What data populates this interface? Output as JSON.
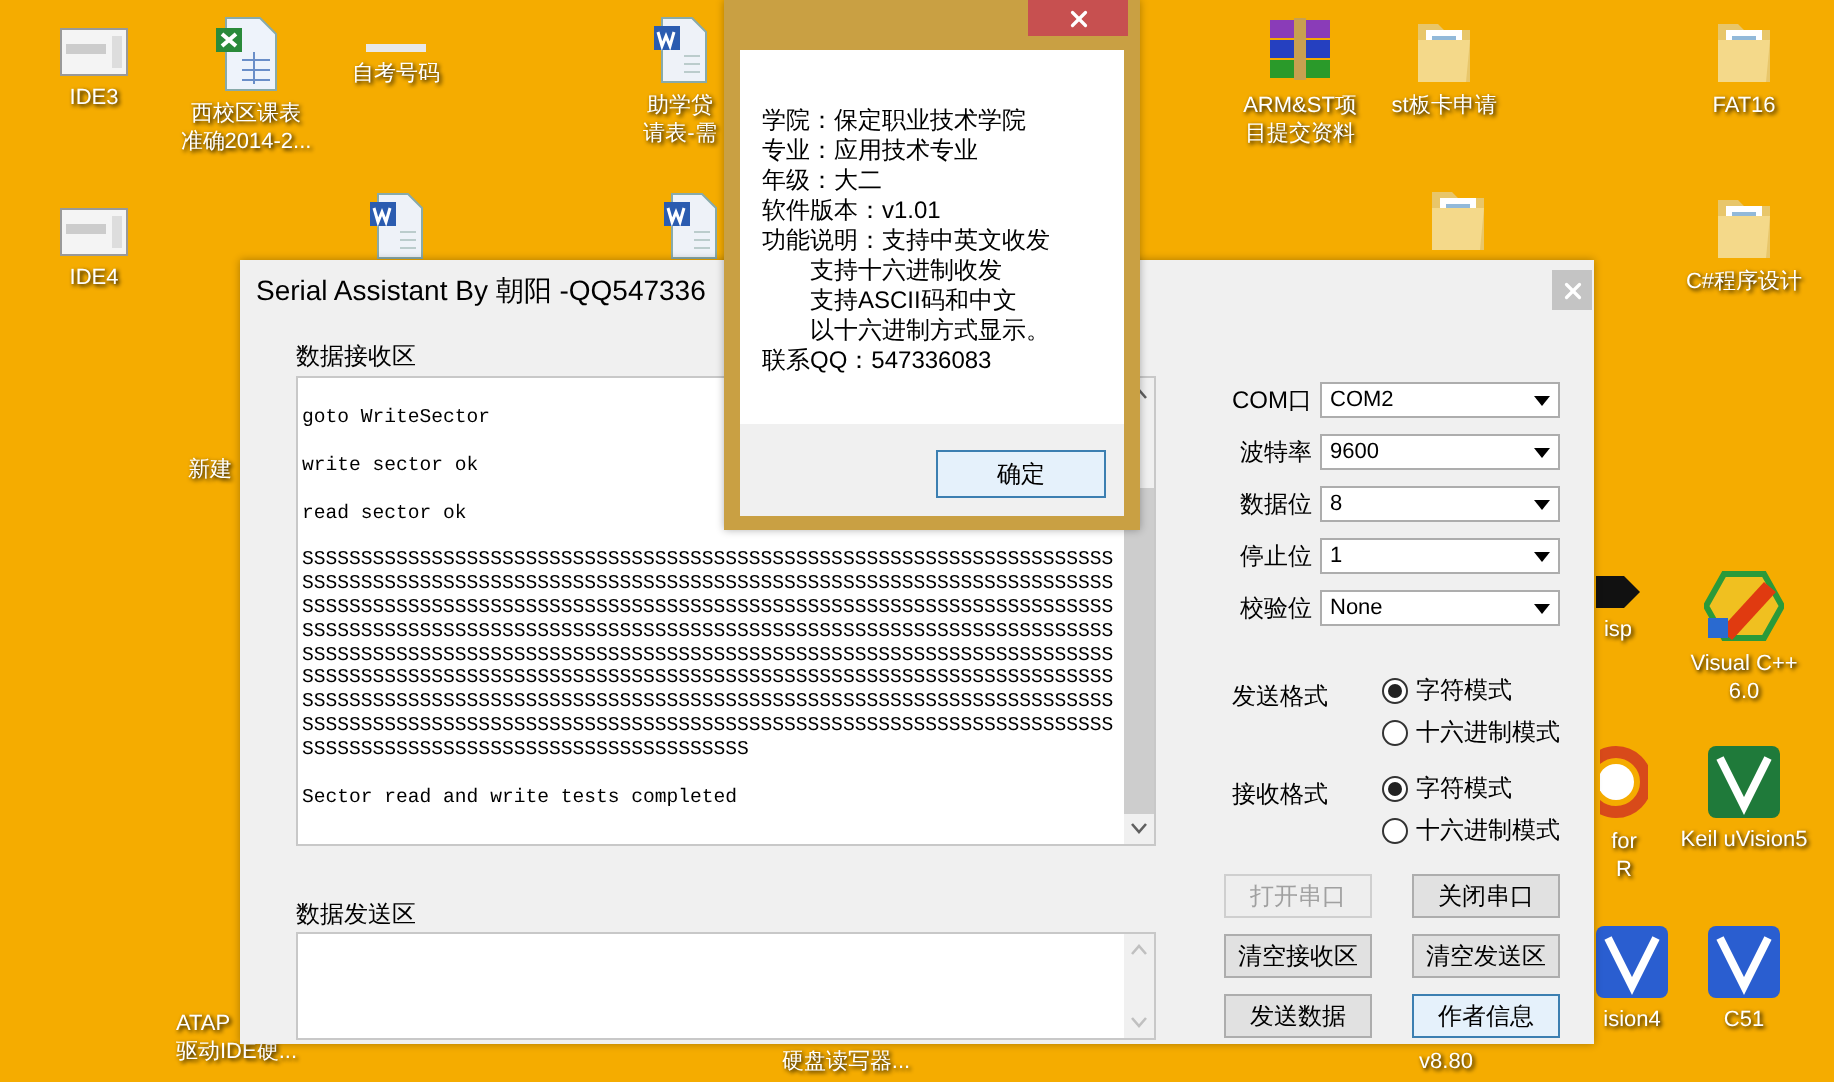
{
  "desktop_icons": [
    {
      "kind": "screen",
      "lines": [
        "IDE3"
      ]
    },
    {
      "kind": "excel",
      "lines": [
        "西校区课表",
        "准确2014-2..."
      ]
    },
    {
      "kind": "strip",
      "lines": [
        "自考号码"
      ]
    },
    {
      "kind": "word",
      "lines": [
        "助学贷",
        "请表-需"
      ]
    },
    {
      "kind": "winrar",
      "lines": [
        "ARM&ST项",
        "目提交资料"
      ]
    },
    {
      "kind": "folder",
      "lines": [
        "st板卡申请"
      ]
    },
    {
      "kind": "folder",
      "lines": [
        "FAT16"
      ]
    },
    {
      "kind": "screen",
      "lines": [
        "IDE4"
      ]
    },
    {
      "kind": "word"
    },
    {
      "kind": "word"
    },
    {
      "kind": "folder"
    },
    {
      "kind": "folder",
      "lines": [
        "C#程序设计"
      ]
    },
    {
      "kind": "none",
      "lines": [
        "新建"
      ]
    },
    {
      "kind": "chip",
      "lines": [
        "isp"
      ]
    },
    {
      "kind": "vc",
      "lines": [
        "Visual C++",
        "6.0"
      ]
    },
    {
      "kind": "ring",
      "lines": [
        "for",
        "R"
      ]
    },
    {
      "kind": "keil",
      "lines": [
        "Keil uVision5"
      ]
    },
    {
      "kind": "none",
      "lines": [
        "ATAP",
        "驱动IDE硬..."
      ]
    },
    {
      "kind": "none",
      "lines": [
        "硬盘读写器..."
      ]
    },
    {
      "kind": "none",
      "lines": [
        "v8.80"
      ]
    },
    {
      "kind": "keil4",
      "lines": [
        "ision4"
      ]
    },
    {
      "kind": "keil4",
      "lines": [
        "C51"
      ]
    }
  ],
  "main_window": {
    "title": "Serial Assistant By 朝阳 -QQ547336",
    "receive_label": "数据接收区",
    "receive_lines": [
      "goto WriteSector",
      "write sector ok",
      "read sector ok",
      "SSSSSSSSSSSSSSSSSSSSSSSSSSSSSSSSSSSSSSSSSSSSSSSSSSSSSSSSSSSSSSSSSSSSSSSSSSSSSSSSSSSSSSSSSSSSSSSSSSSSSSSSSSSSSSSSSSSSSSSSSSSSSSSSSSSSSSSSSSSSSSSSSSSSSSSSSSSSSSSSSSSSSSSSSSSSSSSSSSSSSSSSSSSSSSSSSSSSSSSSSSSSSSSSSSSSSSSSSSSSSSSSSSSSSSSSSSSSSSSSSSSSSSSSSSSSSSSSSSSSSSSSSSSSSSSSSSSSSSSSSSSSSSSSSSSSSSSSSSSSSSSSSSSSSSSSSSSSSSSSSSSSSSSSSSSSSSSSSSSSSSSSSSSSSSSSSSSSSSSSSSSSSSSSSSSSSSSSSSSSSSSSSSSSSSSSSSSSSSSSSSSSSSSSSSSSSSSSSSSSSSSSSSSSSSSSSSSSSSSSSSSSSSSSSSSSSSSSSSSSSSSSSSSSSSSSSSSSSSSSSSSSSSSSSSSSSSSSSSSSSSSSSSSSSSSSSSSSSSSSSSSSSSSSSSSSSSSSSSSSSSSSSSSSSSSSSSSSSSSSSSSSSSSSSSSSSSSSSSSSSSSSSSSSSS",
      "Sector read and write tests completed"
    ],
    "send_label": "数据发送区",
    "settings": [
      {
        "label": "COM口",
        "value": "COM2"
      },
      {
        "label": "波特率",
        "value": "9600"
      },
      {
        "label": "数据位",
        "value": "8"
      },
      {
        "label": "停止位",
        "value": "1"
      },
      {
        "label": "校验位",
        "value": "None"
      }
    ],
    "send_format": {
      "label": "发送格式",
      "options": [
        {
          "label": "字符模式",
          "selected": true
        },
        {
          "label": "十六进制模式",
          "selected": false
        }
      ]
    },
    "receive_format": {
      "label": "接收格式",
      "options": [
        {
          "label": "字符模式",
          "selected": true
        },
        {
          "label": "十六进制模式",
          "selected": false
        }
      ]
    },
    "buttons": [
      {
        "label": "打开串口",
        "disabled": true,
        "focused": false
      },
      {
        "label": "关闭串口",
        "disabled": false,
        "focused": false
      },
      {
        "label": "清空接收区",
        "disabled": false,
        "focused": false
      },
      {
        "label": "清空发送区",
        "disabled": false,
        "focused": false
      },
      {
        "label": "发送数据",
        "disabled": false,
        "focused": false
      },
      {
        "label": "作者信息",
        "disabled": false,
        "focused": true
      }
    ]
  },
  "about_dialog": {
    "lines": [
      {
        "text": "学院：保定职业技术学院",
        "indented": false
      },
      {
        "text": "专业：应用技术专业",
        "indented": false
      },
      {
        "text": "年级：大二",
        "indented": false
      },
      {
        "text": "软件版本：v1.01",
        "indented": false
      },
      {
        "text": "功能说明：支持中英文收发",
        "indented": false
      },
      {
        "text": "支持十六进制收发",
        "indented": true
      },
      {
        "text": "支持ASCII码和中文",
        "indented": true
      },
      {
        "text": "以十六进制方式显示。",
        "indented": true
      },
      {
        "text": "联系QQ：547336083",
        "indented": false
      }
    ],
    "ok_button": "确定"
  }
}
